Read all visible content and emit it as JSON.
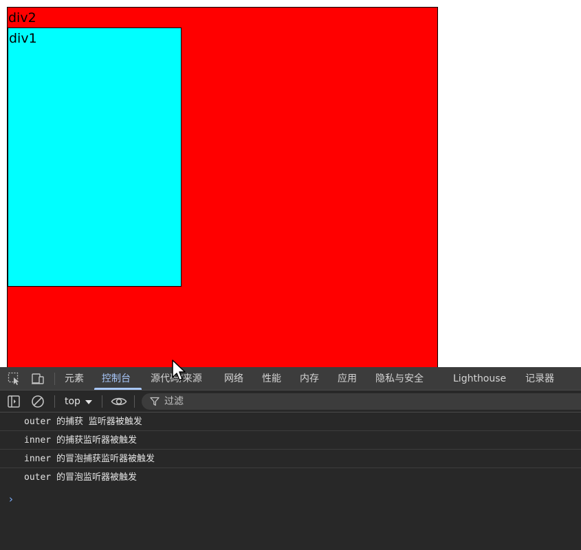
{
  "page": {
    "div2_label": "div2",
    "div1_label": "div1",
    "colors": {
      "div2_bg": "#ff0000",
      "div1_bg": "#00ffff"
    }
  },
  "devtools": {
    "tabs": [
      {
        "label": "元素"
      },
      {
        "label": "控制台",
        "active": true
      },
      {
        "label": "源代码/来源"
      },
      {
        "label": "网络"
      },
      {
        "label": "性能"
      },
      {
        "label": "内存"
      },
      {
        "label": "应用"
      },
      {
        "label": "隐私与安全"
      },
      {
        "label": "Lighthouse"
      },
      {
        "label": "记录器"
      }
    ],
    "icons": {
      "inspect": "inspect-element-icon",
      "device": "device-toolbar-icon",
      "sidebar": "sidebar-toggle-icon",
      "clear": "clear-console-icon",
      "eye": "live-expression-icon",
      "filter": "filter-icon"
    },
    "toolbar": {
      "context": "top",
      "filter_placeholder": "过滤"
    },
    "console": {
      "messages": [
        "outer 的捕获 监听器被触发",
        "inner 的捕获监听器被触发",
        "inner 的冒泡捕获监听器被触发",
        "outer 的冒泡监听器被触发"
      ],
      "prompt": "›"
    },
    "accent_color": "#a8c7fa"
  }
}
